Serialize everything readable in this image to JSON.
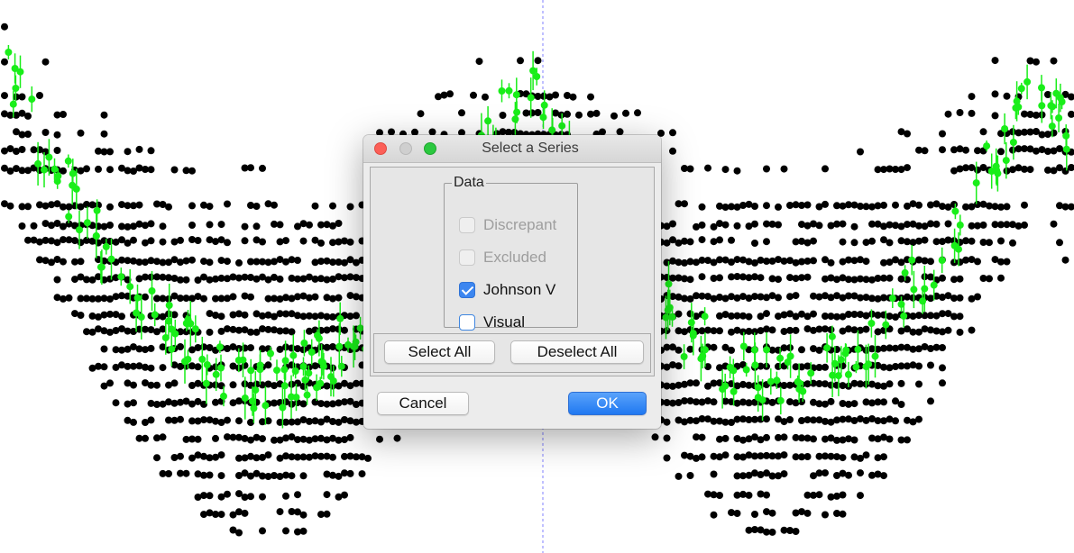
{
  "dialog": {
    "title": "Select a Series",
    "group_label": "Data",
    "series": [
      {
        "label": "Discrepant",
        "checked": false,
        "enabled": false
      },
      {
        "label": "Excluded",
        "checked": false,
        "enabled": false
      },
      {
        "label": "Johnson V",
        "checked": true,
        "enabled": true
      },
      {
        "label": "Visual",
        "checked": false,
        "enabled": true
      }
    ],
    "select_all_label": "Select All",
    "deselect_all_label": "Deselect All",
    "cancel_label": "Cancel",
    "ok_label": "OK"
  },
  "plot": {
    "visual_color": "#000000",
    "johnson_v_color": "#19ee19",
    "crosshair_color": "#8080ff"
  }
}
